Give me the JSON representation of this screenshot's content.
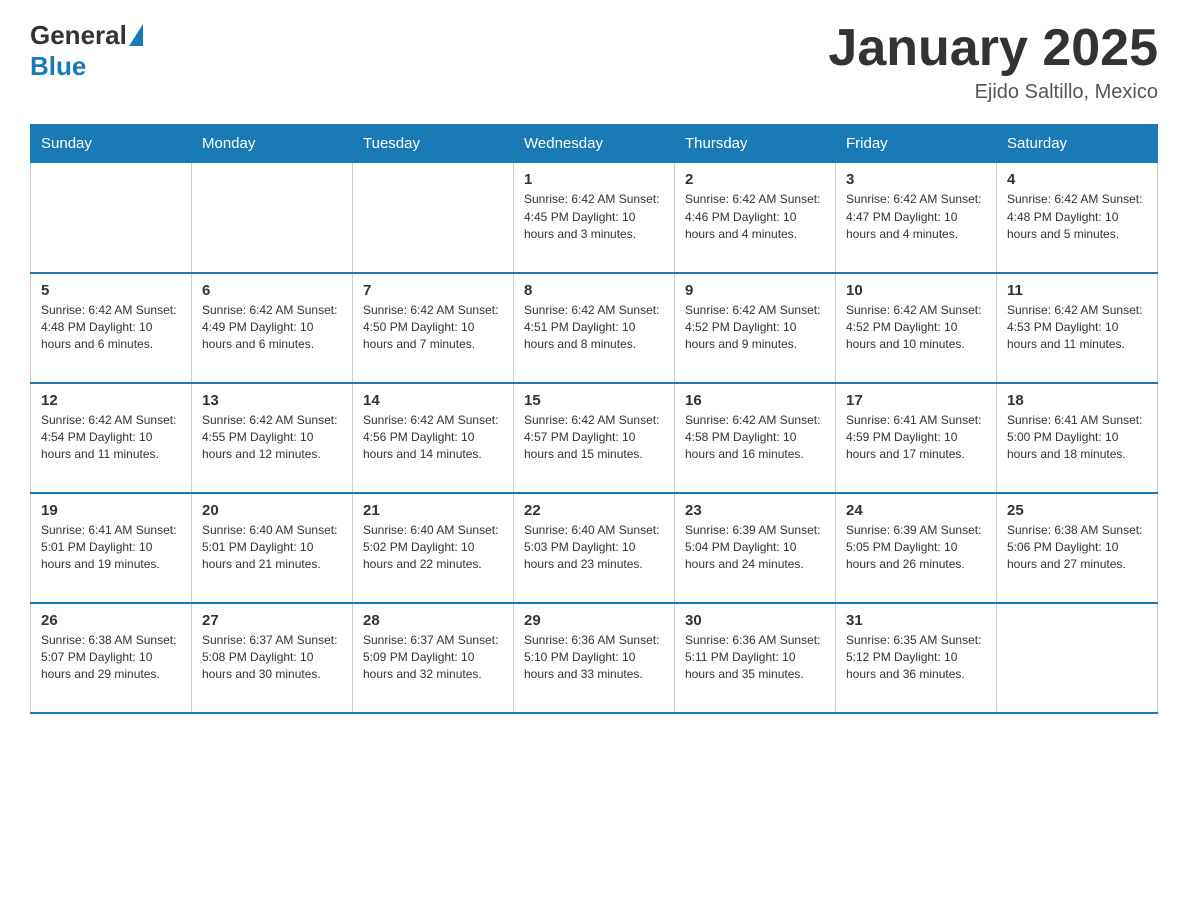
{
  "header": {
    "logo_general": "General",
    "logo_blue": "Blue",
    "title": "January 2025",
    "subtitle": "Ejido Saltillo, Mexico"
  },
  "days_of_week": [
    "Sunday",
    "Monday",
    "Tuesday",
    "Wednesday",
    "Thursday",
    "Friday",
    "Saturday"
  ],
  "weeks": [
    [
      {
        "day": "",
        "info": ""
      },
      {
        "day": "",
        "info": ""
      },
      {
        "day": "",
        "info": ""
      },
      {
        "day": "1",
        "info": "Sunrise: 6:42 AM\nSunset: 4:45 PM\nDaylight: 10 hours and 3 minutes."
      },
      {
        "day": "2",
        "info": "Sunrise: 6:42 AM\nSunset: 4:46 PM\nDaylight: 10 hours and 4 minutes."
      },
      {
        "day": "3",
        "info": "Sunrise: 6:42 AM\nSunset: 4:47 PM\nDaylight: 10 hours and 4 minutes."
      },
      {
        "day": "4",
        "info": "Sunrise: 6:42 AM\nSunset: 4:48 PM\nDaylight: 10 hours and 5 minutes."
      }
    ],
    [
      {
        "day": "5",
        "info": "Sunrise: 6:42 AM\nSunset: 4:48 PM\nDaylight: 10 hours and 6 minutes."
      },
      {
        "day": "6",
        "info": "Sunrise: 6:42 AM\nSunset: 4:49 PM\nDaylight: 10 hours and 6 minutes."
      },
      {
        "day": "7",
        "info": "Sunrise: 6:42 AM\nSunset: 4:50 PM\nDaylight: 10 hours and 7 minutes."
      },
      {
        "day": "8",
        "info": "Sunrise: 6:42 AM\nSunset: 4:51 PM\nDaylight: 10 hours and 8 minutes."
      },
      {
        "day": "9",
        "info": "Sunrise: 6:42 AM\nSunset: 4:52 PM\nDaylight: 10 hours and 9 minutes."
      },
      {
        "day": "10",
        "info": "Sunrise: 6:42 AM\nSunset: 4:52 PM\nDaylight: 10 hours and 10 minutes."
      },
      {
        "day": "11",
        "info": "Sunrise: 6:42 AM\nSunset: 4:53 PM\nDaylight: 10 hours and 11 minutes."
      }
    ],
    [
      {
        "day": "12",
        "info": "Sunrise: 6:42 AM\nSunset: 4:54 PM\nDaylight: 10 hours and 11 minutes."
      },
      {
        "day": "13",
        "info": "Sunrise: 6:42 AM\nSunset: 4:55 PM\nDaylight: 10 hours and 12 minutes."
      },
      {
        "day": "14",
        "info": "Sunrise: 6:42 AM\nSunset: 4:56 PM\nDaylight: 10 hours and 14 minutes."
      },
      {
        "day": "15",
        "info": "Sunrise: 6:42 AM\nSunset: 4:57 PM\nDaylight: 10 hours and 15 minutes."
      },
      {
        "day": "16",
        "info": "Sunrise: 6:42 AM\nSunset: 4:58 PM\nDaylight: 10 hours and 16 minutes."
      },
      {
        "day": "17",
        "info": "Sunrise: 6:41 AM\nSunset: 4:59 PM\nDaylight: 10 hours and 17 minutes."
      },
      {
        "day": "18",
        "info": "Sunrise: 6:41 AM\nSunset: 5:00 PM\nDaylight: 10 hours and 18 minutes."
      }
    ],
    [
      {
        "day": "19",
        "info": "Sunrise: 6:41 AM\nSunset: 5:01 PM\nDaylight: 10 hours and 19 minutes."
      },
      {
        "day": "20",
        "info": "Sunrise: 6:40 AM\nSunset: 5:01 PM\nDaylight: 10 hours and 21 minutes."
      },
      {
        "day": "21",
        "info": "Sunrise: 6:40 AM\nSunset: 5:02 PM\nDaylight: 10 hours and 22 minutes."
      },
      {
        "day": "22",
        "info": "Sunrise: 6:40 AM\nSunset: 5:03 PM\nDaylight: 10 hours and 23 minutes."
      },
      {
        "day": "23",
        "info": "Sunrise: 6:39 AM\nSunset: 5:04 PM\nDaylight: 10 hours and 24 minutes."
      },
      {
        "day": "24",
        "info": "Sunrise: 6:39 AM\nSunset: 5:05 PM\nDaylight: 10 hours and 26 minutes."
      },
      {
        "day": "25",
        "info": "Sunrise: 6:38 AM\nSunset: 5:06 PM\nDaylight: 10 hours and 27 minutes."
      }
    ],
    [
      {
        "day": "26",
        "info": "Sunrise: 6:38 AM\nSunset: 5:07 PM\nDaylight: 10 hours and 29 minutes."
      },
      {
        "day": "27",
        "info": "Sunrise: 6:37 AM\nSunset: 5:08 PM\nDaylight: 10 hours and 30 minutes."
      },
      {
        "day": "28",
        "info": "Sunrise: 6:37 AM\nSunset: 5:09 PM\nDaylight: 10 hours and 32 minutes."
      },
      {
        "day": "29",
        "info": "Sunrise: 6:36 AM\nSunset: 5:10 PM\nDaylight: 10 hours and 33 minutes."
      },
      {
        "day": "30",
        "info": "Sunrise: 6:36 AM\nSunset: 5:11 PM\nDaylight: 10 hours and 35 minutes."
      },
      {
        "day": "31",
        "info": "Sunrise: 6:35 AM\nSunset: 5:12 PM\nDaylight: 10 hours and 36 minutes."
      },
      {
        "day": "",
        "info": ""
      }
    ]
  ]
}
